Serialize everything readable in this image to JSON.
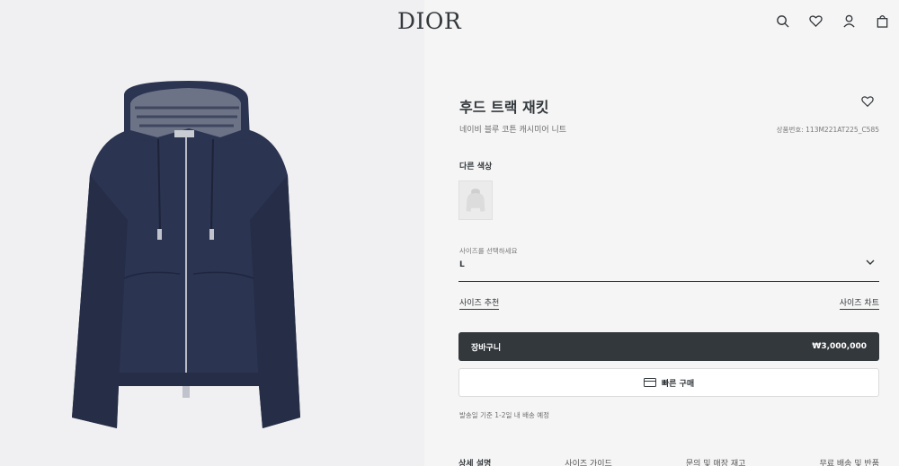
{
  "header": {
    "logo": "DIOR",
    "icons": [
      "search-icon",
      "heart-icon",
      "user-icon",
      "bag-icon"
    ]
  },
  "product": {
    "title": "후드 트랙 재킷",
    "subtitle": "네이비 블루 코튼 캐시미어 니트",
    "ref": "상품번호: 113M221AT225_C585",
    "other_colors_label": "다른 색상",
    "size_label": "사이즈를 선택하세요",
    "size_value": "L",
    "size_reco": "사이즈 추천",
    "size_chart": "사이즈 차트",
    "cart_label": "장바구니",
    "price": "₩3,000,000",
    "quick_buy": "빠른 구매",
    "shipping_note": "발송일 기준 1-2일 내 배송 예정"
  },
  "tabs": [
    "상세 설명",
    "사이즈 가이드",
    "문의 및 매장 재고",
    "무료 배송 및 반품"
  ],
  "colors": {
    "primary": "#33383c",
    "image_bg": "#f0f0f2",
    "panel_bg": "#f5f5f5",
    "jacket": "#2a3350"
  }
}
